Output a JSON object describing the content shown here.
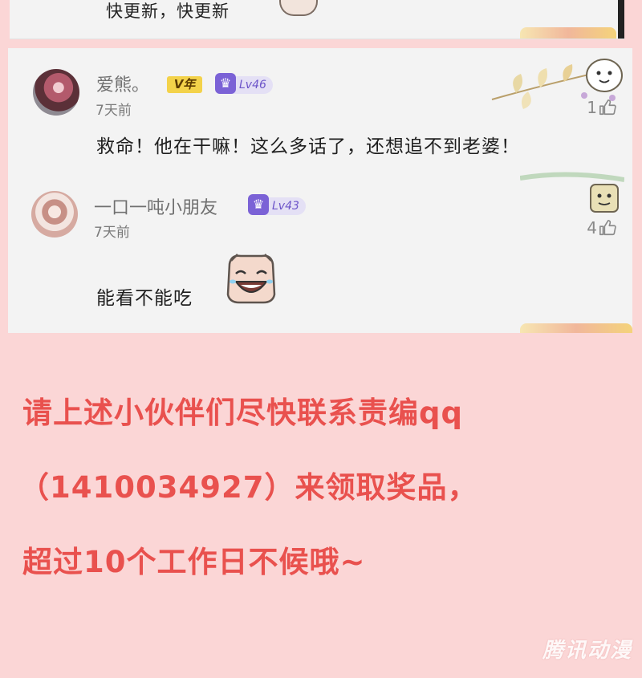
{
  "previous_comment": {
    "text": "快更新，快更新"
  },
  "comments": [
    {
      "username": "爱熊。",
      "vip_badge": "V年",
      "level": "Lv46",
      "time": "7天前",
      "likes": "1",
      "text": "救命！他在干嘛！这么多话了，还想追不到老婆！"
    },
    {
      "username": "一口一吨小朋友",
      "level": "Lv43",
      "time": "7天前",
      "likes": "4",
      "text": "能看不能吃"
    }
  ],
  "notice": {
    "line1": "请上述小伙伴们尽快联系责编qq",
    "line2": "（1410034927）来领取奖品，",
    "line3": "超过10个工作日不候哦~"
  },
  "watermark": "腾讯动漫",
  "colors": {
    "page_bg": "#fbd6d6",
    "card_bg": "#f3f3f3",
    "notice_text": "#e9514e",
    "level_badge": "#6d55c9",
    "vip_badge": "#f3d24a"
  },
  "icons": {
    "like": "thumb-up-icon",
    "level": "crown-icon"
  }
}
